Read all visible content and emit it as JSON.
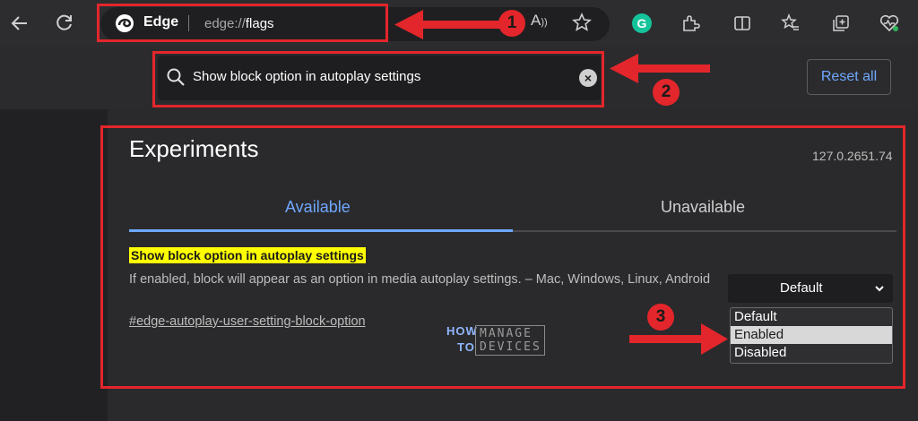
{
  "browser": {
    "name": "Edge",
    "url_scheme": "edge://",
    "url_path": "flags",
    "reader_icon_text": "Ȃ"
  },
  "search": {
    "value": "Show block option in autoplay settings",
    "clear_glyph": "×"
  },
  "header": {
    "reset_label": "Reset all"
  },
  "experiments": {
    "title": "Experiments",
    "version": "127.0.2651.74",
    "tabs": [
      {
        "label": "Available",
        "active": true
      },
      {
        "label": "Unavailable",
        "active": false
      }
    ]
  },
  "flag": {
    "name": "Show block option in autoplay settings",
    "description": "If enabled, block will appear as an option in media autoplay settings. – Mac, Windows, Linux, Android",
    "link": "#edge-autoplay-user-setting-block-option",
    "select_value": "Default",
    "options": [
      "Default",
      "Enabled",
      "Disabled"
    ],
    "highlighted_option": "Enabled"
  },
  "watermark": {
    "how": "HOW",
    "to": "TO",
    "manage": "MANAGE",
    "devices": "DEVICES"
  },
  "annotations": {
    "badges": [
      "1",
      "2",
      "3"
    ],
    "color": "#e3262b"
  },
  "icons": [
    "back-arrow-icon",
    "refresh-icon",
    "edge-logo-icon",
    "read-aloud-icon",
    "favorite-star-icon",
    "grammarly-icon",
    "extensions-icon",
    "split-screen-icon",
    "favorites-icon",
    "collections-icon",
    "browser-essentials-icon",
    "search-icon",
    "clear-icon",
    "chevron-down-icon"
  ]
}
